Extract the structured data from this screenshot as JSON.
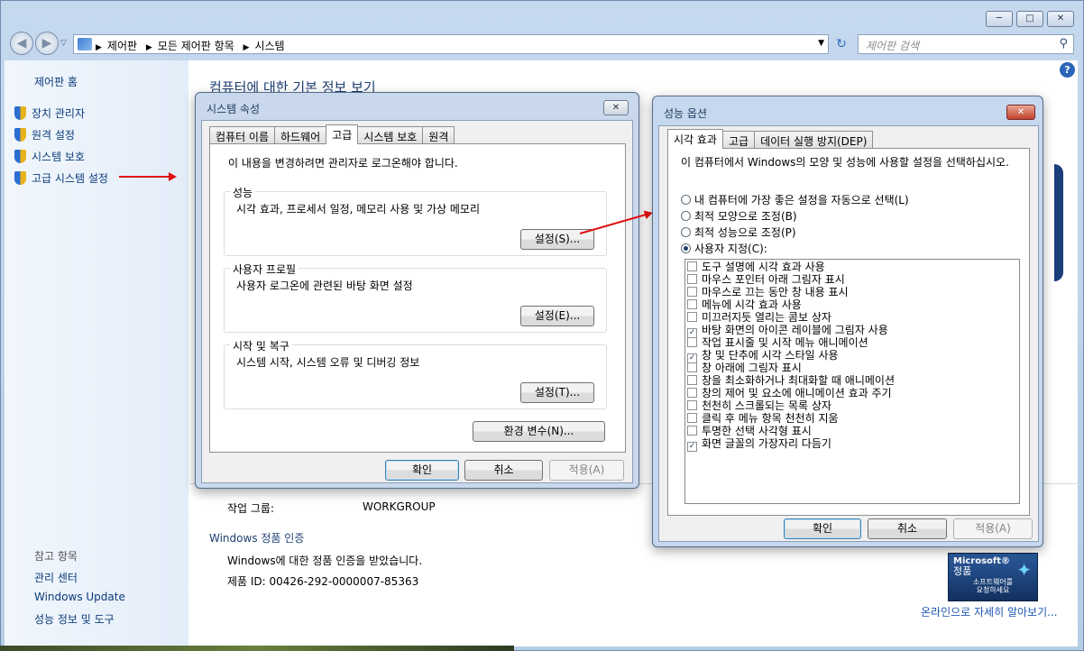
{
  "window": {
    "minimize": "─",
    "maximize": "□",
    "close": "✕"
  },
  "address": {
    "breadcrumb": [
      "제어판",
      "모든 제어판 항목",
      "시스템"
    ],
    "search_placeholder": "제어판 검색"
  },
  "left": {
    "home": "제어판 홈",
    "links": [
      "장치 관리자",
      "원격 설정",
      "시스템 보호",
      "고급 시스템 설정"
    ],
    "see_also_title": "참고 항목",
    "see_also": [
      "관리 센터",
      "Windows Update",
      "성능 정보 및 도구"
    ]
  },
  "main": {
    "title": "컴퓨터에 대한 기본 정보 보기",
    "workgroup_label": "작업 그룹:",
    "workgroup_value": "WORKGROUP",
    "activation_title": "Windows 정품 인증",
    "activation_status": "Windows에 대한 정품 인증을 받았습니다.",
    "product_id": "제품 ID: 00426-292-0000007-85363",
    "genuine_badge_line1": "Microsoft®",
    "genuine_badge_line2": "정품",
    "genuine_badge_line3": "소프트웨어를",
    "genuine_badge_line4": "요청하세요",
    "online_more": "온라인으로 자세히 알아보기...",
    "help": "?"
  },
  "sysprops": {
    "title": "시스템 속성",
    "close": "✕",
    "tabs": [
      "컴퓨터 이름",
      "하드웨어",
      "고급",
      "시스템 보호",
      "원격"
    ],
    "selected_tab": "고급",
    "admin_note": "이 내용을 변경하려면 관리자로 로그온해야 합니다.",
    "perf_title": "성능",
    "perf_desc": "시각 효과, 프로세서 일정, 메모리 사용 및 가상 메모리",
    "perf_btn": "설정(S)...",
    "profile_title": "사용자 프로필",
    "profile_desc": "사용자 로그온에 관련된 바탕 화면 설정",
    "profile_btn": "설정(E)...",
    "startup_title": "시작 및 복구",
    "startup_desc": "시스템 시작, 시스템 오류 및 디버깅 정보",
    "startup_btn": "설정(T)...",
    "env_btn": "환경 변수(N)...",
    "ok": "확인",
    "cancel": "취소",
    "apply": "적용(A)"
  },
  "perfopts": {
    "title": "성능 옵션",
    "close": "✕",
    "tabs": [
      "시각 효과",
      "고급",
      "데이터 실행 방지(DEP)"
    ],
    "selected_tab": "시각 효과",
    "intro": "이 컴퓨터에서 Windows의 모양 및 성능에 사용할 설정을 선택하십시오.",
    "radios": [
      {
        "label": "내 컴퓨터에 가장 좋은 설정을 자동으로 선택(L)",
        "checked": false
      },
      {
        "label": "최적 모양으로 조정(B)",
        "checked": false
      },
      {
        "label": "최적 성능으로 조정(P)",
        "checked": false
      },
      {
        "label": "사용자 지정(C):",
        "checked": true
      }
    ],
    "effects": [
      {
        "label": "도구 설명에 시각 효과 사용",
        "checked": false
      },
      {
        "label": "마우스 포인터 아래 그림자 표시",
        "checked": false
      },
      {
        "label": "마우스로 끄는 동안 창 내용 표시",
        "checked": false
      },
      {
        "label": "메뉴에 시각 효과 사용",
        "checked": false
      },
      {
        "label": "미끄러지듯 열리는 콤보 상자",
        "checked": false
      },
      {
        "label": "바탕 화면의 아이콘 레이블에 그림자 사용",
        "checked": true
      },
      {
        "label": "작업 표시줄 및 시작 메뉴 애니메이션",
        "checked": false
      },
      {
        "label": "창 및 단추에 시각 스타일 사용",
        "checked": true
      },
      {
        "label": "창 아래에 그림자 표시",
        "checked": false
      },
      {
        "label": "창을 최소화하거나 최대화할 때 애니메이션",
        "checked": false
      },
      {
        "label": "창의 제어 및 요소에 애니메이션 효과 주기",
        "checked": false
      },
      {
        "label": "천천히 스크롤되는 목록 상자",
        "checked": false
      },
      {
        "label": "클릭 후 메뉴 항목 천천히 지움",
        "checked": false
      },
      {
        "label": "투명한 선택 사각형 표시",
        "checked": false
      },
      {
        "label": "화면 글꼴의 가장자리 다듬기",
        "checked": true
      }
    ],
    "ok": "확인",
    "cancel": "취소",
    "apply": "적용(A)"
  },
  "colors": {
    "accent": "#0b3b7a",
    "arrow": "#e01010"
  }
}
